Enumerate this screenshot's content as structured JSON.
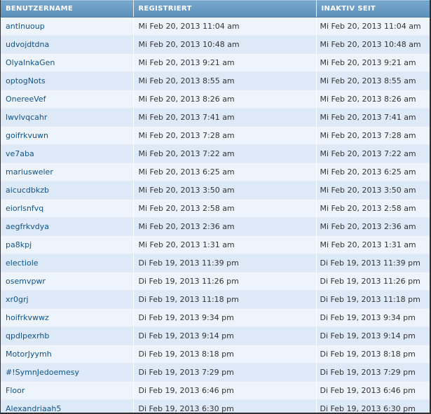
{
  "table": {
    "headers": [
      "BENUTZERNAME",
      "REGISTRIERT",
      "INAKTIV SEIT"
    ],
    "rows": [
      {
        "username": "antinuoup",
        "registered": "Mi Feb 20, 2013 11:04 am",
        "inactive_since": "Mi Feb 20, 2013 11:04 am"
      },
      {
        "username": "udvojdtdna",
        "registered": "Mi Feb 20, 2013 10:48 am",
        "inactive_since": "Mi Feb 20, 2013 10:48 am"
      },
      {
        "username": "OlyaInkaGen",
        "registered": "Mi Feb 20, 2013 9:21 am",
        "inactive_since": "Mi Feb 20, 2013 9:21 am"
      },
      {
        "username": "optogNots",
        "registered": "Mi Feb 20, 2013 8:55 am",
        "inactive_since": "Mi Feb 20, 2013 8:55 am"
      },
      {
        "username": "OnereeVef",
        "registered": "Mi Feb 20, 2013 8:26 am",
        "inactive_since": "Mi Feb 20, 2013 8:26 am"
      },
      {
        "username": "lwvlvqcahr",
        "registered": "Mi Feb 20, 2013 7:41 am",
        "inactive_since": "Mi Feb 20, 2013 7:41 am"
      },
      {
        "username": "goifrkvuwn",
        "registered": "Mi Feb 20, 2013 7:28 am",
        "inactive_since": "Mi Feb 20, 2013 7:28 am"
      },
      {
        "username": "ve7aba",
        "registered": "Mi Feb 20, 2013 7:22 am",
        "inactive_since": "Mi Feb 20, 2013 7:22 am"
      },
      {
        "username": "mariusweler",
        "registered": "Mi Feb 20, 2013 6:25 am",
        "inactive_since": "Mi Feb 20, 2013 6:25 am"
      },
      {
        "username": "aicucdbkzb",
        "registered": "Mi Feb 20, 2013 3:50 am",
        "inactive_since": "Mi Feb 20, 2013 3:50 am"
      },
      {
        "username": "eiorlsnfvq",
        "registered": "Mi Feb 20, 2013 2:58 am",
        "inactive_since": "Mi Feb 20, 2013 2:58 am"
      },
      {
        "username": "aegfrkvdya",
        "registered": "Mi Feb 20, 2013 2:36 am",
        "inactive_since": "Mi Feb 20, 2013 2:36 am"
      },
      {
        "username": "pa8kpj",
        "registered": "Mi Feb 20, 2013 1:31 am",
        "inactive_since": "Mi Feb 20, 2013 1:31 am"
      },
      {
        "username": "electiole",
        "registered": "Di Feb 19, 2013 11:39 pm",
        "inactive_since": "Di Feb 19, 2013 11:39 pm"
      },
      {
        "username": "osemvpwr",
        "registered": "Di Feb 19, 2013 11:26 pm",
        "inactive_since": "Di Feb 19, 2013 11:26 pm"
      },
      {
        "username": "xr0grj",
        "registered": "Di Feb 19, 2013 11:18 pm",
        "inactive_since": "Di Feb 19, 2013 11:18 pm"
      },
      {
        "username": "hoifrkvwwz",
        "registered": "Di Feb 19, 2013 9:34 pm",
        "inactive_since": "Di Feb 19, 2013 9:34 pm"
      },
      {
        "username": "qpdlpexrhb",
        "registered": "Di Feb 19, 2013 9:14 pm",
        "inactive_since": "Di Feb 19, 2013 9:14 pm"
      },
      {
        "username": "MotorJyymh",
        "registered": "Di Feb 19, 2013 8:18 pm",
        "inactive_since": "Di Feb 19, 2013 8:18 pm"
      },
      {
        "username": "#!SymnJedoemesy",
        "registered": "Di Feb 19, 2013 7:29 pm",
        "inactive_since": "Di Feb 19, 2013 7:29 pm"
      },
      {
        "username": "Floor",
        "registered": "Di Feb 19, 2013 6:46 pm",
        "inactive_since": "Di Feb 19, 2013 6:46 pm"
      },
      {
        "username": "Alexandriaah5",
        "registered": "Di Feb 19, 2013 6:30 pm",
        "inactive_since": "Di Feb 19, 2013 6:30 pm"
      }
    ]
  }
}
